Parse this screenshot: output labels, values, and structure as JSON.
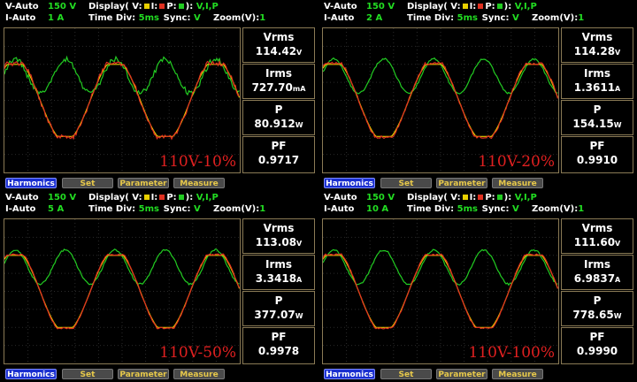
{
  "colors": {
    "voltage": "#e8d000",
    "current": "#e03020",
    "power": "#22cc22",
    "grid": "#2a2a2a",
    "border": "#8a7a55"
  },
  "labels": {
    "v_auto": "V-Auto",
    "i_auto": "I-Auto",
    "display": "Display( V:",
    "i": "I:",
    "p": "P:",
    "display_end": "):",
    "display_val": "V,I,P",
    "time_div": "Time Div:",
    "sync": "Sync:",
    "sync_val": "V",
    "zoom": "Zoom(V):",
    "zoom_val": "1",
    "vrms": "Vrms",
    "irms": "Irms",
    "p_name": "P",
    "pf": "PF",
    "unit_v": "V",
    "unit_w": "W",
    "harmonics": "Harmonics",
    "set": "Set",
    "parameter": "Parameter",
    "measure": "Measure"
  },
  "panels": [
    {
      "v_range": "150 V",
      "i_range": "1 A",
      "time_div": "5ms",
      "condition": "110V-10%",
      "vrms": "114.42",
      "irms": "727.70",
      "irms_unit": "mA",
      "p": "80.912",
      "pf": "0.9717"
    },
    {
      "v_range": "150 V",
      "i_range": "2 A",
      "time_div": "5ms",
      "condition": "110V-20%",
      "vrms": "114.28",
      "irms": "1.3611",
      "irms_unit": "A",
      "p": "154.15",
      "pf": "0.9910"
    },
    {
      "v_range": "150 V",
      "i_range": "5 A",
      "time_div": "5ms",
      "condition": "110V-50%",
      "vrms": "113.08",
      "irms": "3.3418",
      "irms_unit": "A",
      "p": "377.07",
      "pf": "0.9978"
    },
    {
      "v_range": "150 V",
      "i_range": "10 A",
      "time_div": "5ms",
      "condition": "110V-100%",
      "vrms": "111.60",
      "irms": "6.9837",
      "irms_unit": "A",
      "p": "778.65",
      "pf": "0.9990"
    }
  ]
}
